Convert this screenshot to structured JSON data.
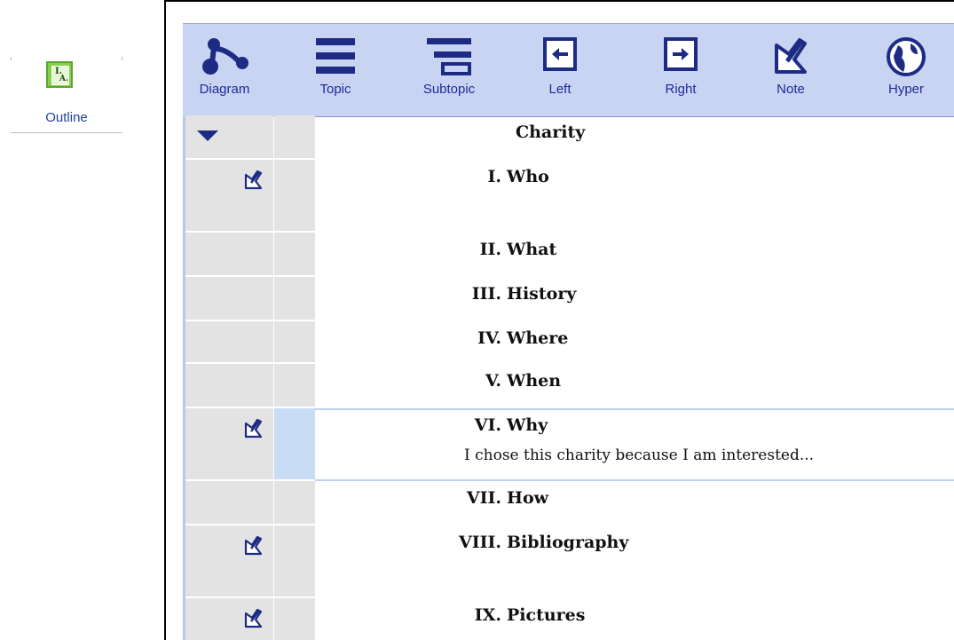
{
  "view_switch": {
    "label": "Outline",
    "icon": "outline-icon",
    "icon_letters": [
      "I.",
      "A."
    ]
  },
  "toolbar": {
    "items": [
      {
        "label": "Diagram",
        "icon": "diagram-icon"
      },
      {
        "label": "Topic",
        "icon": "topic-icon"
      },
      {
        "label": "Subtopic",
        "icon": "subtopic-icon"
      },
      {
        "label": "Left",
        "icon": "left-arrow-icon"
      },
      {
        "label": "Right",
        "icon": "right-arrow-icon"
      },
      {
        "label": "Note",
        "icon": "note-icon"
      },
      {
        "label": "Hyper",
        "icon": "hyperlink-globe-icon"
      }
    ]
  },
  "outline": {
    "root": {
      "title": "Charity"
    },
    "topics": [
      {
        "numeral": "I.",
        "title": "Who",
        "has_note": true,
        "note_text": ""
      },
      {
        "numeral": "II.",
        "title": "What",
        "has_note": false
      },
      {
        "numeral": "III.",
        "title": "History",
        "has_note": false
      },
      {
        "numeral": "IV.",
        "title": "Where",
        "has_note": false
      },
      {
        "numeral": "V.",
        "title": "When",
        "has_note": false
      },
      {
        "numeral": "VI.",
        "title": "Why",
        "has_note": true,
        "note_text": "I chose this charity because I am interested..."
      },
      {
        "numeral": "VII.",
        "title": "How",
        "has_note": false
      },
      {
        "numeral": "VIII.",
        "title": "Bibliography",
        "has_note": true,
        "note_text": ""
      },
      {
        "numeral": "IX.",
        "title": "Pictures",
        "has_note": true,
        "note_text": ""
      }
    ]
  },
  "colors": {
    "toolbar_bg": "#c8d4f2",
    "toolbar_text": "#1e2b9a",
    "icon_navy": "#1d2b84",
    "gutter_bg": "#e3e3e3",
    "selection": "#c9dcf6",
    "outline_green": "#86cf4a"
  }
}
